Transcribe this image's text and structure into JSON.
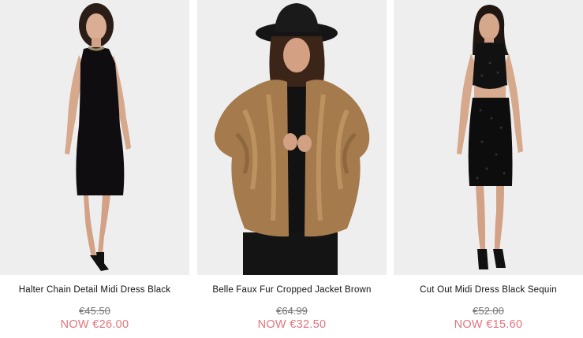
{
  "colors": {
    "sale": "#e4737d",
    "was": "#777777",
    "title": "#111111",
    "photo_bg": "#efefef"
  },
  "products": [
    {
      "name": "Halter Chain Detail Midi Dress Black",
      "was_price": "€45.50",
      "now_price": "NOW €26.00",
      "image": "model-black-halter-midi-dress"
    },
    {
      "name": "Belle Faux Fur Cropped Jacket Brown",
      "was_price": "€64.99",
      "now_price": "NOW €32.50",
      "image": "model-brown-faux-fur-jacket-black-hat"
    },
    {
      "name": "Cut Out Midi Dress Black Sequin",
      "was_price": "€52.00",
      "now_price": "NOW €15.60",
      "image": "model-black-sequin-cut-out-midi-dress"
    }
  ]
}
